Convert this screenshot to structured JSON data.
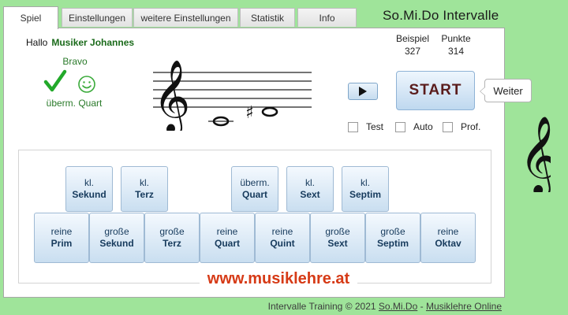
{
  "app_title": "So.Mi.Do Intervalle",
  "tabs": [
    {
      "label": "Spiel",
      "active": true
    },
    {
      "label": "Einstellungen"
    },
    {
      "label": "weitere Einstellungen"
    },
    {
      "label": "Statistik"
    },
    {
      "label": "Info"
    }
  ],
  "greeting": {
    "prefix": "Hallo",
    "user": "Musiker Johannes"
  },
  "feedback": {
    "text": "Bravo",
    "answer": "überm. Quart"
  },
  "stats": {
    "beispiel_label": "Beispiel",
    "beispiel_value": "327",
    "punkte_label": "Punkte",
    "punkte_value": "314"
  },
  "controls": {
    "start_label": "START",
    "tooltip": "Weiter",
    "options": [
      "Test",
      "Auto",
      "Prof."
    ]
  },
  "intervals_top": [
    {
      "l1": "kl.",
      "l2": "Sekund"
    },
    {
      "l1": "kl.",
      "l2": "Terz"
    },
    {
      "l1": "überm.",
      "l2": "Quart"
    },
    {
      "l1": "kl.",
      "l2": "Sext"
    },
    {
      "l1": "kl.",
      "l2": "Septim"
    }
  ],
  "intervals_bottom": [
    {
      "l1": "reine",
      "l2": "Prim"
    },
    {
      "l1": "große",
      "l2": "Sekund"
    },
    {
      "l1": "große",
      "l2": "Terz"
    },
    {
      "l1": "reine",
      "l2": "Quart"
    },
    {
      "l1": "reine",
      "l2": "Quint"
    },
    {
      "l1": "große",
      "l2": "Sext"
    },
    {
      "l1": "große",
      "l2": "Septim"
    },
    {
      "l1": "reine",
      "l2": "Oktav"
    }
  ],
  "website": "www.musiklehre.at",
  "footer": {
    "text": "Intervalle Training © 2021",
    "link1": "So.Mi.Do",
    "separator": "-",
    "link2": "Musiklehre Online"
  },
  "colors": {
    "background": "#9fe49a",
    "feedback_green": "#2a7a2a",
    "website_red": "#d63a16",
    "start_text": "#5a1c1c"
  }
}
